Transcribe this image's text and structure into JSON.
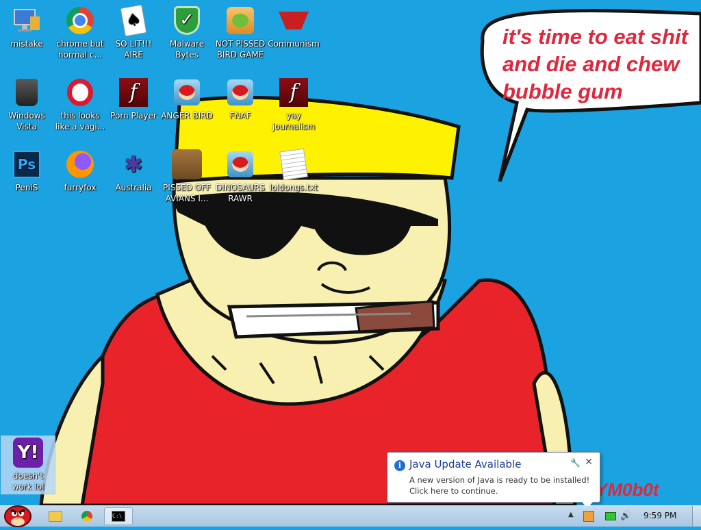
{
  "desktop": {
    "background_color": "#1aa3e0",
    "icons": [
      {
        "label": "mistake",
        "icon": "computer-icon"
      },
      {
        "label": "chrome but normal c...",
        "icon": "chrome-icon"
      },
      {
        "label": "SO LIT!!! AIRE",
        "icon": "solitaire-icon"
      },
      {
        "label": "Malware Bytes",
        "icon": "malwarebytes-icon"
      },
      {
        "label": "NOT PISSED BIRD GAME",
        "icon": "bad-piggies-icon"
      },
      {
        "label": "Communism",
        "icon": "communism-icon"
      },
      {
        "label": "Windows Vista",
        "icon": "recycle-bin-icon"
      },
      {
        "label": "this looks like a vagi...",
        "icon": "opera-icon"
      },
      {
        "label": "Porn Player",
        "icon": "flash-player-icon"
      },
      {
        "label": "ANGER BIRD",
        "icon": "angry-birds-icon"
      },
      {
        "label": "FNAF",
        "icon": "angry-birds-icon"
      },
      {
        "label": "yay journalism",
        "icon": "flash-player-icon"
      },
      {
        "label": "PeniS",
        "icon": "photoshop-icon"
      },
      {
        "label": "furryfox",
        "icon": "firefox-icon"
      },
      {
        "label": "Australia",
        "icon": "spider-solitaire-icon"
      },
      {
        "label": "PISSED OFF AVIANS I...",
        "icon": "angry-birds-seasons-icon"
      },
      {
        "label": "DINOSAURS RAWR",
        "icon": "angry-birds-icon"
      },
      {
        "label": "loldongs.txt",
        "icon": "text-file-icon"
      },
      {
        "label": "doesn't work lol",
        "icon": "yahoo-messenger-icon"
      }
    ]
  },
  "wallpaper": {
    "speech_bubble_lines": [
      "it's time to eat shit",
      "and die and chew",
      "bubble gum"
    ],
    "signature": "YM0b0t"
  },
  "notification": {
    "title": "Java Update Available",
    "message_line1": "A new version of Java is ready to be installed!",
    "message_line2": "Click here to continue."
  },
  "taskbar": {
    "start_icon": "angry-bird-start-icon",
    "pinned": [
      "folder-icon",
      "chrome-icon",
      "cmd-icon"
    ],
    "clock": "9:59 PM"
  }
}
